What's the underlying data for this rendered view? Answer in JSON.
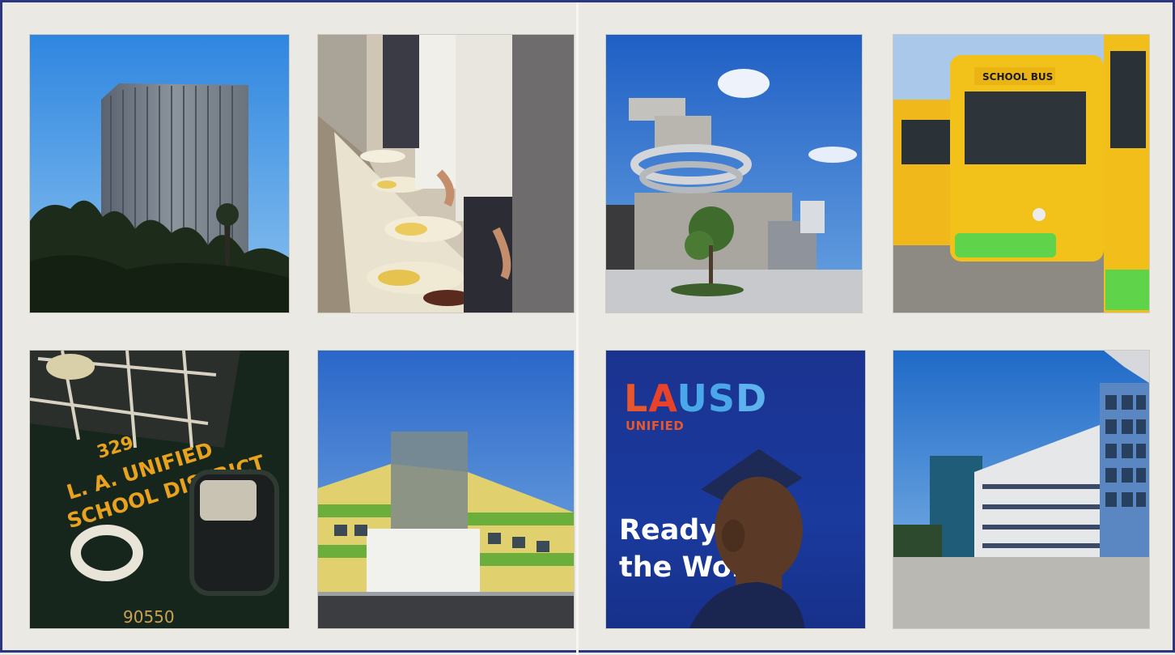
{
  "tiles": [
    {
      "subject": "office-tower"
    },
    {
      "subject": "cafeteria-food-line"
    },
    {
      "subject": "modern-concrete-building"
    },
    {
      "subject": "school-buses"
    },
    {
      "subject": "district-vehicle-door"
    },
    {
      "subject": "colorful-school-building"
    },
    {
      "subject": "lausd-banner"
    },
    {
      "subject": "school-campus-building"
    }
  ],
  "bus_door": {
    "number": "329",
    "line1": "L. A. UNIFIED",
    "line2": "SCHOOL DISTRICT",
    "plate": "90550"
  },
  "bus": {
    "sign": "SCHOOL BUS"
  },
  "lausd_banner": {
    "logo_letters": [
      "L",
      "A",
      "U",
      "S",
      "D"
    ],
    "logo_sub": "UNIFIED",
    "tagline_line1": "Ready for",
    "tagline_line2": "the World"
  },
  "colors": {
    "frame": "#2b3580",
    "background": "#ebe9e4",
    "sky": "#3c7fd2",
    "bus_yellow": "#f3c21a",
    "banner_blue": "#1b3390",
    "logo_orange": "#e8572c",
    "logo_blue": "#4aa8ea"
  }
}
